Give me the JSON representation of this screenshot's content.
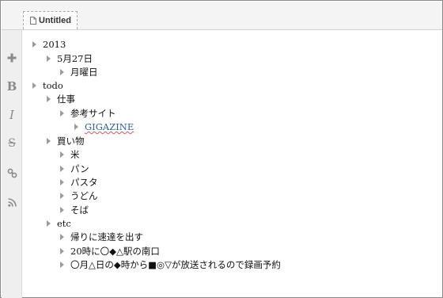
{
  "tab": {
    "title": "Untitled"
  },
  "toolbar": {
    "icons": [
      "plus-icon",
      "bold-icon",
      "italic-icon",
      "strikethrough-icon",
      "link-icon",
      "rss-icon"
    ],
    "bold_glyph": "B",
    "italic_glyph": "I",
    "strike_glyph": "S"
  },
  "outline": [
    {
      "text": "2013"
    },
    {
      "text": "5月27日"
    },
    {
      "text": "月曜日"
    },
    {
      "text": "todo"
    },
    {
      "text": "仕事"
    },
    {
      "text": "参考サイト"
    },
    {
      "text": "GIGAZINE",
      "link": true
    },
    {
      "text": "買い物"
    },
    {
      "text": "米"
    },
    {
      "text": "パン"
    },
    {
      "text": "パスタ"
    },
    {
      "text": "うどん"
    },
    {
      "text": "そば"
    },
    {
      "text": "etc"
    },
    {
      "text": "帰りに速達を出す"
    },
    {
      "text": "20時に〇◆△駅の南口"
    },
    {
      "text": "〇月△日の◆時から■◎▽が放送されるので録画予約"
    }
  ]
}
